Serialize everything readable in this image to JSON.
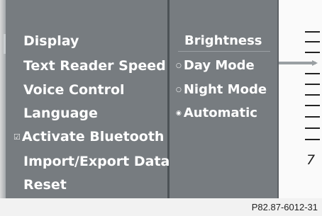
{
  "menu": {
    "items": [
      {
        "label": "Display",
        "checked": false
      },
      {
        "label": "Text Reader Speed",
        "checked": false
      },
      {
        "label": "Voice Control",
        "checked": false
      },
      {
        "label": "Language",
        "checked": false
      },
      {
        "label": "Activate Bluetooth",
        "checked": true
      },
      {
        "label": "Import/Export Data",
        "checked": false
      },
      {
        "label": "Reset",
        "checked": false
      }
    ]
  },
  "brightness": {
    "title": "Brightness",
    "options": [
      {
        "label": "Day Mode",
        "selected": false
      },
      {
        "label": "Night Mode",
        "selected": false
      },
      {
        "label": "Automatic",
        "selected": true
      }
    ]
  },
  "scale": {
    "number": "7"
  },
  "icons": {
    "checkbox": "checkbox-checked-icon",
    "radio_empty": "radio-empty-icon",
    "radio_selected": "radio-selected-icon"
  },
  "colors": {
    "panel": "#777c80",
    "divider": "#4c5256",
    "text": "#ffffff"
  },
  "footer": {
    "code": "P82.87-6012-31"
  }
}
